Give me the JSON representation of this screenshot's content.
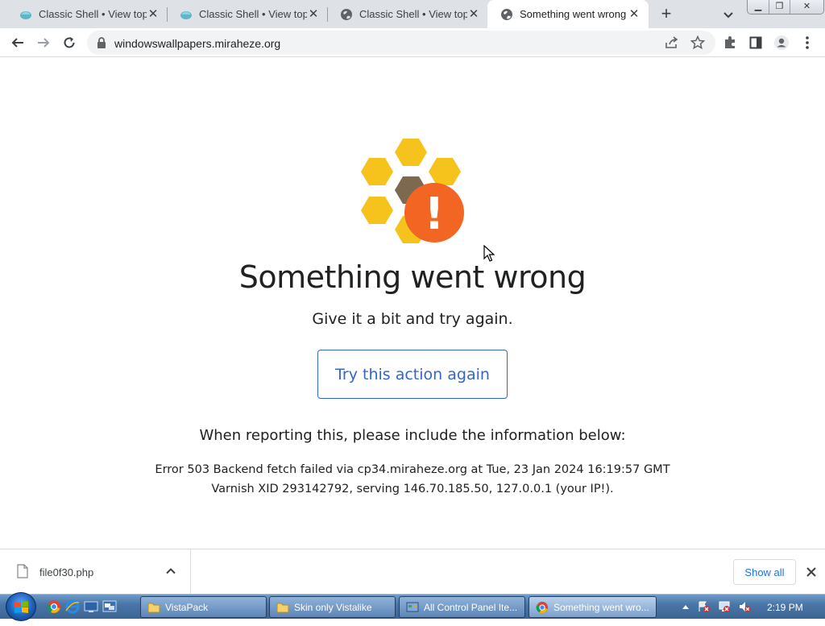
{
  "browser": {
    "tabs": [
      {
        "title": "Classic Shell • View topic",
        "active": false,
        "favicon": "classic-shell-icon"
      },
      {
        "title": "Classic Shell • View topic",
        "active": false,
        "favicon": "classic-shell-icon"
      },
      {
        "title": "Classic Shell • View topic",
        "active": false,
        "favicon": "globe-icon"
      },
      {
        "title": "Something went wrong",
        "active": true,
        "favicon": "globe-icon"
      }
    ],
    "address": "windowswallpapers.miraheze.org"
  },
  "page": {
    "heading": "Something went wrong",
    "subheading": "Give it a bit and try again.",
    "retry_button": "Try this action again",
    "report_text": "When reporting this, please include the information below:",
    "error_line1": "Error 503 Backend fetch failed via cp34.miraheze.org at Tue, 23 Jan 2024 16:19:57 GMT",
    "error_line2": "Varnish XID 293142792, serving 146.70.185.50, 127.0.0.1 (your IP!).",
    "logo_exclaim": "!",
    "colors": {
      "accent": "#3366cc",
      "honey": "#f6c31c",
      "error": "#f26522",
      "brown": "#7d6850"
    }
  },
  "download_shelf": {
    "filename": "file0f30.php",
    "show_all": "Show all"
  },
  "taskbar": {
    "tasks": [
      {
        "label": "VistaPack",
        "icon": "folder-icon"
      },
      {
        "label": "Skin only Vistalike",
        "icon": "folder-icon"
      },
      {
        "label": "All Control Panel Ite...",
        "icon": "control-panel-icon"
      },
      {
        "label": "Something went wro...",
        "icon": "chrome-icon"
      }
    ],
    "clock": "2:19 PM"
  }
}
